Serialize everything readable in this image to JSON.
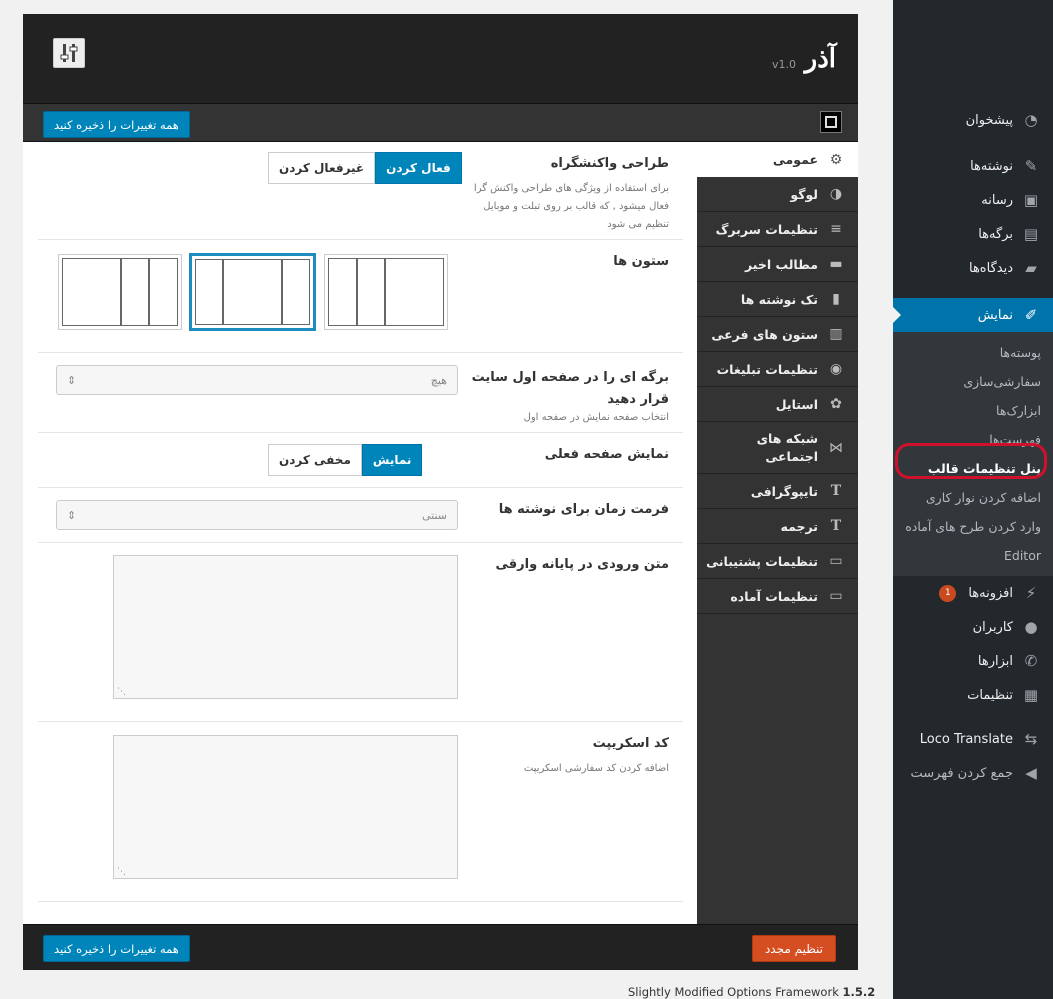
{
  "sidebar": {
    "items": [
      {
        "label": "پیشخوان",
        "icon": "dashboard-icon",
        "glyph": "◔"
      },
      {
        "label": "نوشته‌ها",
        "icon": "pin-icon",
        "glyph": "✎"
      },
      {
        "label": "رسانه",
        "icon": "media-icon",
        "glyph": "▣"
      },
      {
        "label": "برگه‌ها",
        "icon": "pages-icon",
        "glyph": "▤"
      },
      {
        "label": "دیدگاه‌ها",
        "icon": "comments-icon",
        "glyph": "▰"
      }
    ],
    "current": {
      "label": "نمایش",
      "icon": "appearance-brush-icon",
      "glyph": "✐"
    },
    "submenu": [
      "پوسته‌ها",
      "سفارشی‌سازی",
      "ابزارک‌ها",
      "فهرست‌ها",
      "پنل تنظیمات قالب",
      "اضافه کردن نوار کاری",
      "وارد کردن طرح های آماده",
      "Editor"
    ],
    "items_after": [
      {
        "label": "افزونه‌ها",
        "icon": "plugins-icon",
        "glyph": "⚡",
        "badge": "1"
      },
      {
        "label": "کاربران",
        "icon": "users-icon",
        "glyph": "●"
      },
      {
        "label": "ابزارها",
        "icon": "tools-wrench-icon",
        "glyph": "✆"
      },
      {
        "label": "تنظیمات",
        "icon": "settings-icon",
        "glyph": "▦"
      }
    ],
    "extra": [
      {
        "label": "Loco Translate",
        "icon": "translate-icon",
        "glyph": "⇆"
      },
      {
        "label": "جمع کردن فهرست",
        "icon": "collapse-icon",
        "glyph": "◀"
      }
    ]
  },
  "panel": {
    "title": "آذر",
    "version": "v1.0",
    "save_label": "همه تغییرات را ذخیره کنید",
    "reset_label": "تنظیم مجدد"
  },
  "nav": [
    {
      "label": "عمومی",
      "icon": "gear-icon",
      "glyph": "⚙"
    },
    {
      "label": "لوگو",
      "icon": "logo-icon",
      "glyph": "◑"
    },
    {
      "label": "تنظیمات سربرگ",
      "icon": "header-lines-icon",
      "glyph": "≡"
    },
    {
      "label": "مطالب اخیر",
      "icon": "folder-icon",
      "glyph": "▬"
    },
    {
      "label": "تک نوشته ها",
      "icon": "single-post-icon",
      "glyph": "▮"
    },
    {
      "label": "ستون های فرعی",
      "icon": "sidebar-columns-icon",
      "glyph": "▥"
    },
    {
      "label": "تنظیمات تبلیغات",
      "icon": "ads-lightbulb-icon",
      "glyph": "◉"
    },
    {
      "label": "استایل",
      "icon": "palette-icon",
      "glyph": "✿"
    },
    {
      "label": "شبکه های اجتماعی",
      "icon": "share-icon",
      "glyph": "⋈"
    },
    {
      "label": "تایپوگرافی",
      "icon": "typography-icon",
      "glyph": "T"
    },
    {
      "label": "ترجمه",
      "icon": "translation-icon",
      "glyph": "T"
    },
    {
      "label": "تنظیمات پشتیبانی",
      "icon": "floppy-icon",
      "glyph": "▭"
    },
    {
      "label": "تنظیمات آماده",
      "icon": "floppy-icon",
      "glyph": "▭"
    }
  ],
  "fields": {
    "responsive": {
      "label": "طراحی واکنشگراه",
      "desc": "برای استفاده از ویژگی های طراحی واکنش گرا فعال میشود , که قالب بر روی تبلت و موبایل تنظیم می شود",
      "on": "فعال کردن",
      "off": "غیرفعال کردن"
    },
    "columns": {
      "label": "ستون ها"
    },
    "front_page": {
      "label": "برگه ای را در صفحه اول سایت قرار دهید",
      "desc": "انتخاب صفحه نمایش در صفحه اول",
      "value": "هیچ"
    },
    "current_page": {
      "label": "نمایش صفحه فعلی",
      "on": "نمایش",
      "off": "مخفی کردن"
    },
    "time_format": {
      "label": "فرمت زمان برای نوشته ها",
      "value": "سنتی"
    },
    "login_text": {
      "label": "متن ورودی در پایانه وارقی"
    },
    "script": {
      "label": "کد اسکریپت",
      "desc": "اضافه کردن کد سفارشی اسکریپت"
    }
  },
  "credit": {
    "text": "Slightly Modified Options Framework ",
    "version": "1.5.2"
  },
  "colors": {
    "accent": "#0085ba",
    "wp_current": "#0073aa",
    "reset": "#d54e21",
    "highlight": "#d0112b"
  }
}
